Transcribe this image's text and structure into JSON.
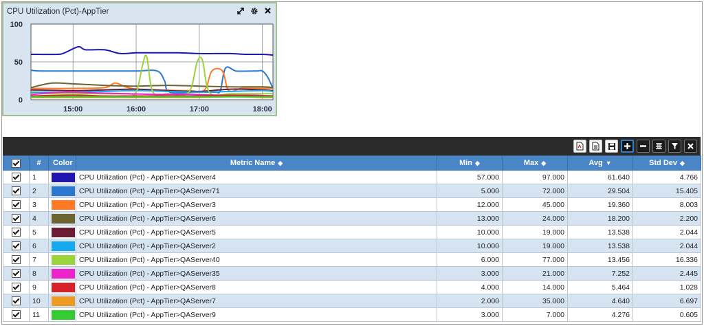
{
  "widget": {
    "title": "CPU Utilization (Pct)-AppTier",
    "icons": [
      "expand-icon",
      "gear-icon",
      "close-icon"
    ]
  },
  "chart_data": {
    "type": "line",
    "y_ticks": [
      "100",
      "50",
      "0"
    ],
    "ylim": [
      0,
      100
    ],
    "x_ticks": [
      "15:00",
      "16:00",
      "17:00",
      "18:00"
    ],
    "x_range": [
      "14:20",
      "18:10"
    ],
    "grid": true,
    "series": [
      {
        "color": "#2016b0",
        "x": [
          "14:20",
          "14:45",
          "14:52",
          "15:05",
          "15:12",
          "15:30",
          "15:45",
          "16:00",
          "16:20",
          "16:40",
          "17:00",
          "17:15",
          "17:30",
          "17:45",
          "18:00",
          "18:10"
        ],
        "values": [
          60,
          60,
          62,
          70,
          66,
          66,
          61,
          62,
          62,
          62,
          61,
          61,
          61,
          60,
          60,
          59
        ]
      },
      {
        "color": "#2a78cf",
        "x": [
          "14:20",
          "14:30",
          "15:00",
          "15:30",
          "16:00",
          "16:20",
          "16:27",
          "16:32",
          "17:00",
          "17:15",
          "17:20",
          "17:25",
          "17:35",
          "17:50",
          "17:55",
          "18:00",
          "18:05",
          "18:10"
        ],
        "values": [
          39,
          38,
          38,
          38,
          38,
          38,
          25,
          10,
          10,
          10,
          12,
          42,
          38,
          38,
          38,
          38,
          30,
          15
        ]
      },
      {
        "color": "#ff7a22",
        "x": [
          "14:20",
          "15:00",
          "15:30",
          "15:40",
          "15:50",
          "16:00",
          "16:20",
          "16:50",
          "17:05",
          "17:12",
          "17:22",
          "17:28",
          "17:40",
          "18:00",
          "18:10"
        ],
        "values": [
          15,
          15,
          16,
          22,
          17,
          14,
          13,
          12,
          13,
          38,
          38,
          12,
          15,
          15,
          15
        ]
      },
      {
        "color": "#6b6330",
        "x": [
          "14:20",
          "14:40",
          "15:00",
          "15:30",
          "16:00",
          "16:30",
          "17:00",
          "17:30",
          "18:00",
          "18:10"
        ],
        "values": [
          16,
          22,
          21,
          19,
          18,
          19,
          18,
          17,
          17,
          16
        ]
      },
      {
        "color": "#6b1c35",
        "x": [
          "14:20",
          "15:00",
          "15:30",
          "16:00",
          "16:30",
          "17:00",
          "17:30",
          "18:00",
          "18:10"
        ],
        "values": [
          13,
          12,
          13,
          14,
          12,
          11,
          14,
          13,
          12
        ]
      },
      {
        "color": "#15a9f0",
        "x": [
          "14:20",
          "15:00",
          "15:30",
          "16:00",
          "16:30",
          "17:00",
          "17:30",
          "18:00",
          "18:10"
        ],
        "values": [
          10,
          10,
          11,
          12,
          11,
          10,
          11,
          12,
          11
        ]
      },
      {
        "color": "#9bd43a",
        "x": [
          "14:20",
          "15:00",
          "15:50",
          "16:00",
          "16:06",
          "16:10",
          "16:16",
          "16:30",
          "16:50",
          "16:58",
          "17:03",
          "17:10",
          "17:30",
          "18:00",
          "18:10"
        ],
        "values": [
          8,
          8,
          8,
          10,
          45,
          57,
          10,
          8,
          10,
          50,
          52,
          9,
          8,
          8,
          8
        ]
      },
      {
        "color": "#ee22cc",
        "x": [
          "14:20",
          "14:50",
          "15:20",
          "15:50",
          "16:20",
          "16:50",
          "17:20",
          "17:50",
          "18:10"
        ],
        "values": [
          7,
          10,
          9,
          8,
          7,
          7,
          6,
          6,
          5
        ]
      },
      {
        "color": "#d8202a",
        "x": [
          "14:20",
          "15:00",
          "15:30",
          "16:00",
          "16:30",
          "17:00",
          "17:30",
          "18:00",
          "18:10"
        ],
        "values": [
          5,
          6,
          5,
          5,
          5,
          5,
          6,
          5,
          5
        ]
      },
      {
        "color": "#ee9a22",
        "x": [
          "14:20",
          "15:00",
          "15:30",
          "16:00",
          "16:30",
          "17:00",
          "17:30",
          "18:00",
          "18:10"
        ],
        "values": [
          3,
          3,
          3,
          3,
          3,
          3,
          4,
          3,
          3
        ]
      },
      {
        "color": "#33cc33",
        "x": [
          "14:20",
          "15:00",
          "15:30",
          "16:00",
          "16:30",
          "17:00",
          "17:30",
          "18:00",
          "18:10"
        ],
        "values": [
          4,
          4,
          4,
          4,
          4,
          4,
          4,
          4,
          4
        ]
      }
    ]
  },
  "toolbar": {
    "buttons": [
      "export-pdf-icon",
      "export-csv-icon",
      "save-icon",
      "add-icon",
      "remove-icon",
      "grid-icon",
      "filter-icon",
      "close-icon"
    ]
  },
  "table": {
    "header": {
      "num": "#",
      "color": "Color",
      "metric": "Metric Name",
      "min": "Min",
      "max": "Max",
      "avg": "Avg",
      "std": "Std Dev"
    },
    "rows": [
      {
        "n": "1",
        "color": "#2016b0",
        "metric": "CPU Utilization (Pct) - AppTier>QAServer4",
        "min": "57.000",
        "max": "97.000",
        "avg": "61.640",
        "std": "4.766"
      },
      {
        "n": "2",
        "color": "#2a78cf",
        "metric": "CPU Utilization (Pct) - AppTier>QAServer71",
        "min": "5.000",
        "max": "72.000",
        "avg": "29.504",
        "std": "15.405"
      },
      {
        "n": "3",
        "color": "#ff7a22",
        "metric": "CPU Utilization (Pct) - AppTier>QAServer3",
        "min": "12.000",
        "max": "45.000",
        "avg": "19.360",
        "std": "8.003"
      },
      {
        "n": "4",
        "color": "#6b6330",
        "metric": "CPU Utilization (Pct) - AppTier>QAServer6",
        "min": "13.000",
        "max": "24.000",
        "avg": "18.200",
        "std": "2.200"
      },
      {
        "n": "5",
        "color": "#6b1c35",
        "metric": "CPU Utilization (Pct) - AppTier>QAServer5",
        "min": "10.000",
        "max": "19.000",
        "avg": "13.538",
        "std": "2.044"
      },
      {
        "n": "6",
        "color": "#15a9f0",
        "metric": "CPU Utilization (Pct) - AppTier>QAServer2",
        "min": "10.000",
        "max": "19.000",
        "avg": "13.538",
        "std": "2.044"
      },
      {
        "n": "7",
        "color": "#9bd43a",
        "metric": "CPU Utilization (Pct) - AppTier>QAServer40",
        "min": "6.000",
        "max": "77.000",
        "avg": "13.456",
        "std": "16.336"
      },
      {
        "n": "8",
        "color": "#ee22cc",
        "metric": "CPU Utilization (Pct) - AppTier>QAServer35",
        "min": "3.000",
        "max": "21.000",
        "avg": "7.252",
        "std": "2.445"
      },
      {
        "n": "9",
        "color": "#d8202a",
        "metric": "CPU Utilization (Pct) - AppTier>QAServer8",
        "min": "4.000",
        "max": "14.000",
        "avg": "5.464",
        "std": "1.028"
      },
      {
        "n": "10",
        "color": "#ee9a22",
        "metric": "CPU Utilization (Pct) - AppTier>QAServer7",
        "min": "2.000",
        "max": "35.000",
        "avg": "4.640",
        "std": "6.697"
      },
      {
        "n": "11",
        "color": "#33cc33",
        "metric": "CPU Utilization (Pct) - AppTier>QAServer9",
        "min": "3.000",
        "max": "7.000",
        "avg": "4.276",
        "std": "0.605"
      }
    ]
  }
}
